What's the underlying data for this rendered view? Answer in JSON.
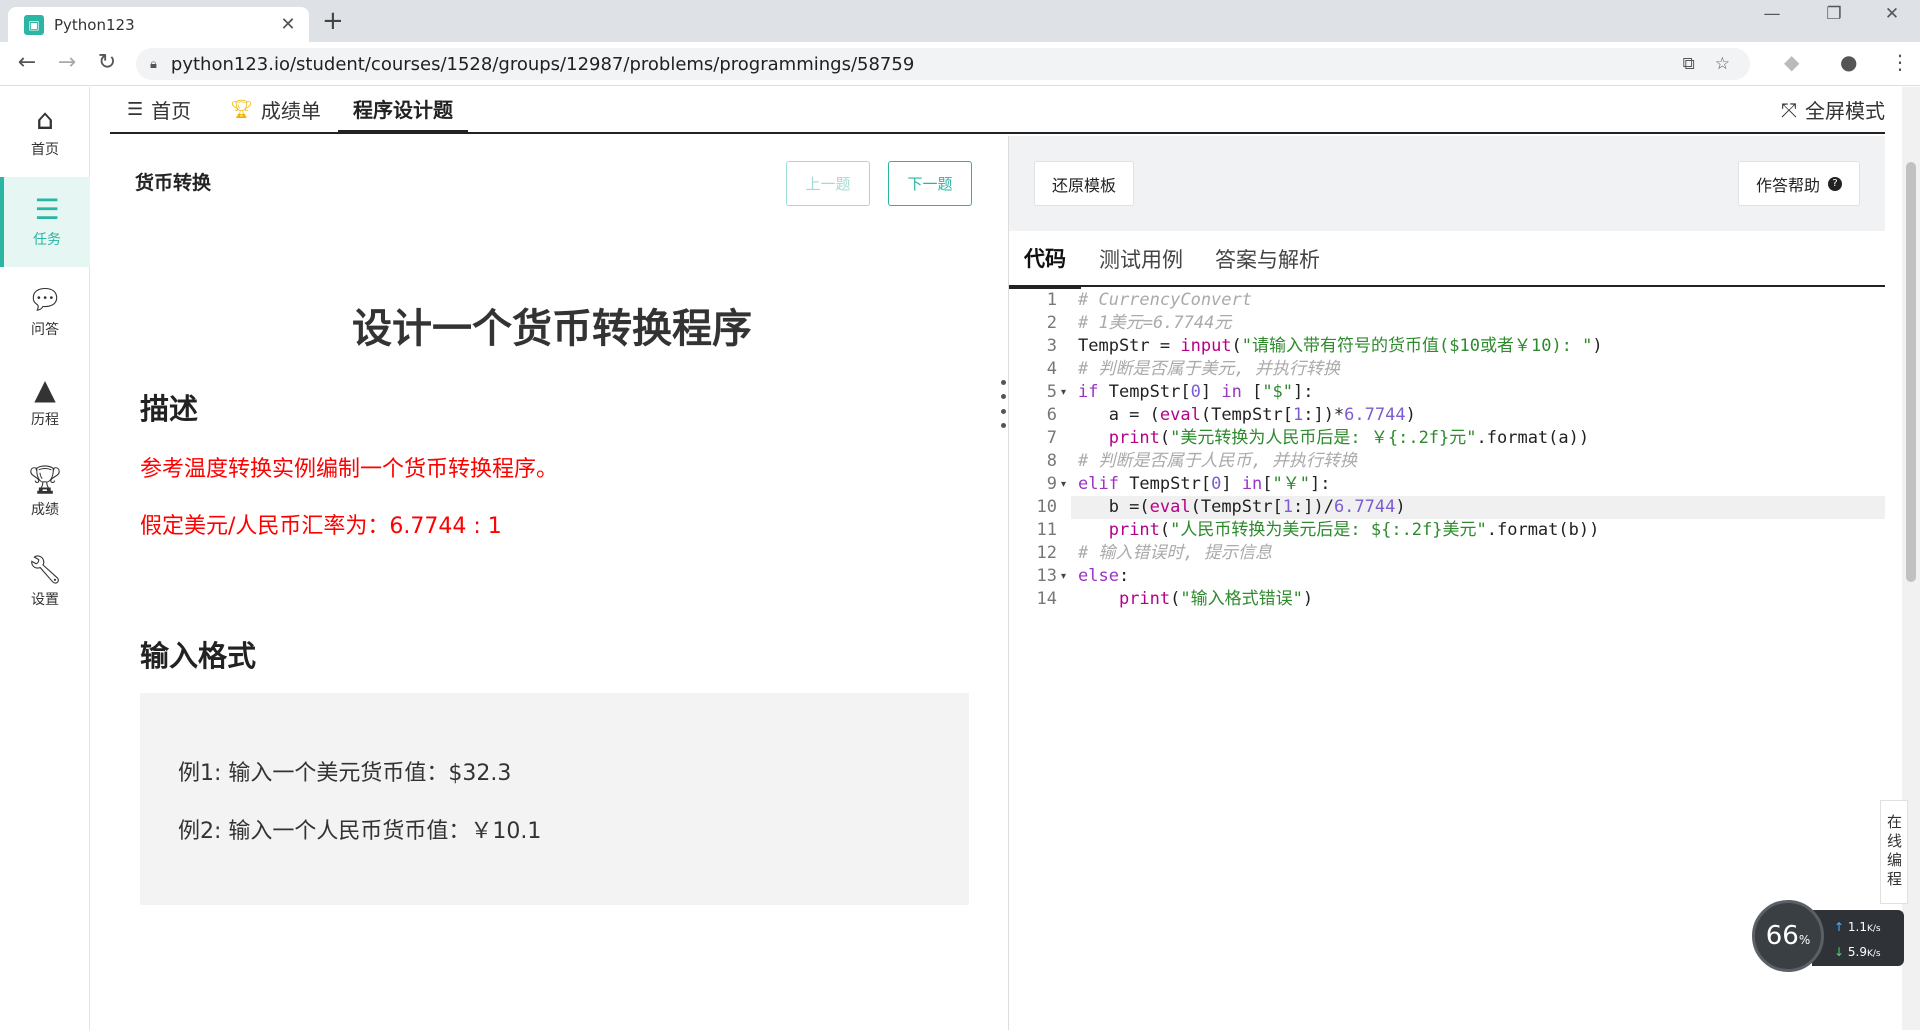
{
  "browser": {
    "tab_title": "Python123",
    "url": "python123.io/student/courses/1528/groups/12987/problems/programmings/58759"
  },
  "sidebar": {
    "items": [
      {
        "label": "首页",
        "icon": "home-icon"
      },
      {
        "label": "任务",
        "icon": "tasks-icon"
      },
      {
        "label": "问答",
        "icon": "chat-icon"
      },
      {
        "label": "历程",
        "icon": "tree-icon"
      },
      {
        "label": "成绩",
        "icon": "trophy-icon"
      },
      {
        "label": "设置",
        "icon": "wrench-icon"
      }
    ],
    "active_index": 1
  },
  "toptabs": {
    "home": "首页",
    "grades": "成绩单",
    "programming": "程序设计题",
    "fullscreen": "全屏模式"
  },
  "problem": {
    "title": "货币转换",
    "prev_label": "上一题",
    "next_label": "下一题",
    "heading": "设计一个货币转换程序",
    "desc_heading": "描述",
    "desc_line1": "参考温度转换实例编制一个货币转换程序。",
    "desc_line2": "假定美元/人民币汇率为：6.7744 : 1",
    "input_heading": "输入格式",
    "example1": "例1: 输入一个美元货币值：$32.3",
    "example2": "例2: 输入一个人民币货币值：￥10.1"
  },
  "editor": {
    "restore_label": "还原模板",
    "help_label": "作答帮助",
    "tabs": [
      "代码",
      "测试用例",
      "答案与解析"
    ],
    "current_line": 10,
    "line_numbers": [
      "1",
      "2",
      "3",
      "4",
      "5",
      "6",
      "7",
      "8",
      "9",
      "10",
      "11",
      "12",
      "13",
      "14"
    ],
    "fold_lines": [
      5,
      9,
      13
    ],
    "code": [
      "# CurrencyConvert",
      "# 1美元=6.7744元",
      "TempStr = input(\"请输入带有符号的货币值($10或者￥10): \")",
      "# 判断是否属于美元, 并执行转换",
      "if TempStr[0] in [\"$\"]:",
      "   a = (eval(TempStr[1:])*6.7744)",
      "   print(\"美元转换为人民币后是: ￥{:.2f}元\".format(a))",
      "# 判断是否属于人民币, 并执行转换",
      "elif TempStr[0] in[\"￥\"]:",
      "   b =(eval(TempStr[1:])/6.7744)",
      "   print(\"人民币转换为美元后是: ${:.2f}美元\".format(b))",
      "# 输入错误时, 提示信息",
      "else:",
      "    print(\"输入格式错误\")"
    ]
  },
  "floating": {
    "online_label": "在线编程",
    "gauge_value": "66",
    "gauge_unit": "%",
    "upload_speed": "1.1",
    "download_speed": "5.9",
    "speed_unit": "K/s"
  }
}
